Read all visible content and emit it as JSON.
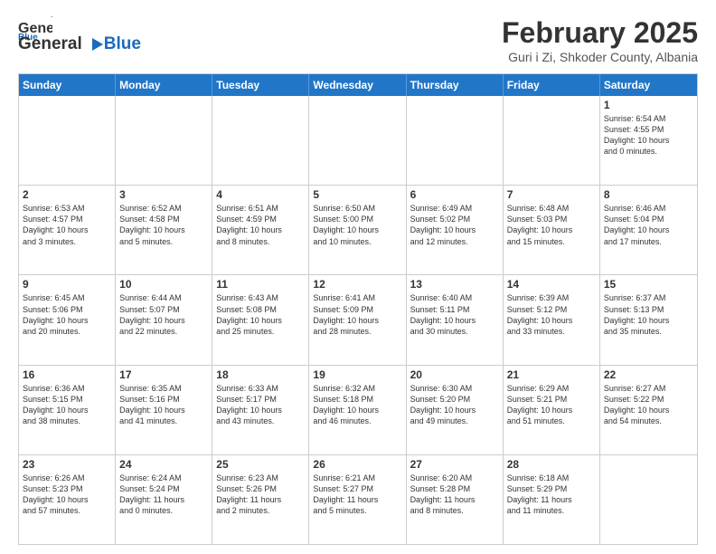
{
  "header": {
    "logo_general": "General",
    "logo_blue": "Blue",
    "month_title": "February 2025",
    "subtitle": "Guri i Zi, Shkoder County, Albania"
  },
  "weekdays": [
    "Sunday",
    "Monday",
    "Tuesday",
    "Wednesday",
    "Thursday",
    "Friday",
    "Saturday"
  ],
  "rows": [
    [
      {
        "day": "",
        "text": ""
      },
      {
        "day": "",
        "text": ""
      },
      {
        "day": "",
        "text": ""
      },
      {
        "day": "",
        "text": ""
      },
      {
        "day": "",
        "text": ""
      },
      {
        "day": "",
        "text": ""
      },
      {
        "day": "1",
        "text": "Sunrise: 6:54 AM\nSunset: 4:55 PM\nDaylight: 10 hours\nand 0 minutes."
      }
    ],
    [
      {
        "day": "2",
        "text": "Sunrise: 6:53 AM\nSunset: 4:57 PM\nDaylight: 10 hours\nand 3 minutes."
      },
      {
        "day": "3",
        "text": "Sunrise: 6:52 AM\nSunset: 4:58 PM\nDaylight: 10 hours\nand 5 minutes."
      },
      {
        "day": "4",
        "text": "Sunrise: 6:51 AM\nSunset: 4:59 PM\nDaylight: 10 hours\nand 8 minutes."
      },
      {
        "day": "5",
        "text": "Sunrise: 6:50 AM\nSunset: 5:00 PM\nDaylight: 10 hours\nand 10 minutes."
      },
      {
        "day": "6",
        "text": "Sunrise: 6:49 AM\nSunset: 5:02 PM\nDaylight: 10 hours\nand 12 minutes."
      },
      {
        "day": "7",
        "text": "Sunrise: 6:48 AM\nSunset: 5:03 PM\nDaylight: 10 hours\nand 15 minutes."
      },
      {
        "day": "8",
        "text": "Sunrise: 6:46 AM\nSunset: 5:04 PM\nDaylight: 10 hours\nand 17 minutes."
      }
    ],
    [
      {
        "day": "9",
        "text": "Sunrise: 6:45 AM\nSunset: 5:06 PM\nDaylight: 10 hours\nand 20 minutes."
      },
      {
        "day": "10",
        "text": "Sunrise: 6:44 AM\nSunset: 5:07 PM\nDaylight: 10 hours\nand 22 minutes."
      },
      {
        "day": "11",
        "text": "Sunrise: 6:43 AM\nSunset: 5:08 PM\nDaylight: 10 hours\nand 25 minutes."
      },
      {
        "day": "12",
        "text": "Sunrise: 6:41 AM\nSunset: 5:09 PM\nDaylight: 10 hours\nand 28 minutes."
      },
      {
        "day": "13",
        "text": "Sunrise: 6:40 AM\nSunset: 5:11 PM\nDaylight: 10 hours\nand 30 minutes."
      },
      {
        "day": "14",
        "text": "Sunrise: 6:39 AM\nSunset: 5:12 PM\nDaylight: 10 hours\nand 33 minutes."
      },
      {
        "day": "15",
        "text": "Sunrise: 6:37 AM\nSunset: 5:13 PM\nDaylight: 10 hours\nand 35 minutes."
      }
    ],
    [
      {
        "day": "16",
        "text": "Sunrise: 6:36 AM\nSunset: 5:15 PM\nDaylight: 10 hours\nand 38 minutes."
      },
      {
        "day": "17",
        "text": "Sunrise: 6:35 AM\nSunset: 5:16 PM\nDaylight: 10 hours\nand 41 minutes."
      },
      {
        "day": "18",
        "text": "Sunrise: 6:33 AM\nSunset: 5:17 PM\nDaylight: 10 hours\nand 43 minutes."
      },
      {
        "day": "19",
        "text": "Sunrise: 6:32 AM\nSunset: 5:18 PM\nDaylight: 10 hours\nand 46 minutes."
      },
      {
        "day": "20",
        "text": "Sunrise: 6:30 AM\nSunset: 5:20 PM\nDaylight: 10 hours\nand 49 minutes."
      },
      {
        "day": "21",
        "text": "Sunrise: 6:29 AM\nSunset: 5:21 PM\nDaylight: 10 hours\nand 51 minutes."
      },
      {
        "day": "22",
        "text": "Sunrise: 6:27 AM\nSunset: 5:22 PM\nDaylight: 10 hours\nand 54 minutes."
      }
    ],
    [
      {
        "day": "23",
        "text": "Sunrise: 6:26 AM\nSunset: 5:23 PM\nDaylight: 10 hours\nand 57 minutes."
      },
      {
        "day": "24",
        "text": "Sunrise: 6:24 AM\nSunset: 5:24 PM\nDaylight: 11 hours\nand 0 minutes."
      },
      {
        "day": "25",
        "text": "Sunrise: 6:23 AM\nSunset: 5:26 PM\nDaylight: 11 hours\nand 2 minutes."
      },
      {
        "day": "26",
        "text": "Sunrise: 6:21 AM\nSunset: 5:27 PM\nDaylight: 11 hours\nand 5 minutes."
      },
      {
        "day": "27",
        "text": "Sunrise: 6:20 AM\nSunset: 5:28 PM\nDaylight: 11 hours\nand 8 minutes."
      },
      {
        "day": "28",
        "text": "Sunrise: 6:18 AM\nSunset: 5:29 PM\nDaylight: 11 hours\nand 11 minutes."
      },
      {
        "day": "",
        "text": ""
      }
    ]
  ]
}
